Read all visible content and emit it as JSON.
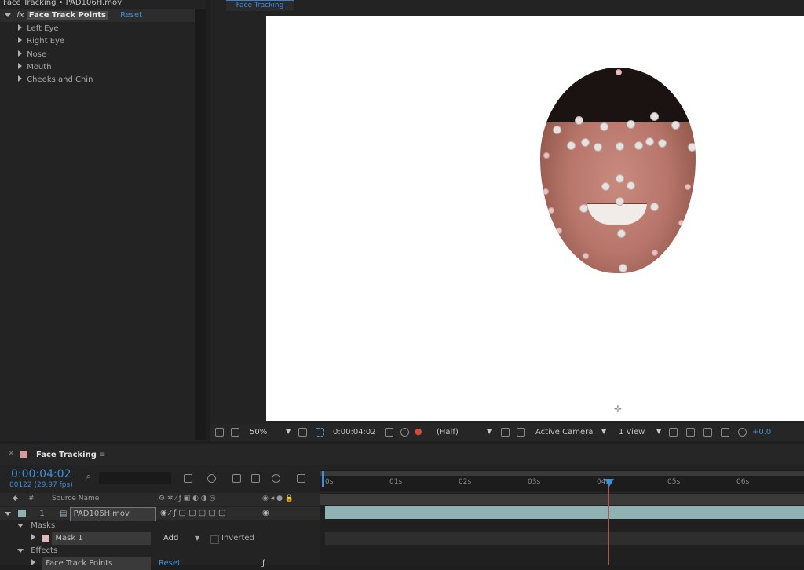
{
  "effect_controls": {
    "title": "Face Tracking • PAD106H.mov",
    "effect_name": "Face Track Points",
    "fx_label": "fx",
    "reset_label": "Reset",
    "groups": [
      "Left Eye",
      "Right Eye",
      "Nose",
      "Mouth",
      "Cheeks and Chin"
    ]
  },
  "viewer": {
    "tab_label": "Face Tracking",
    "toolbar": {
      "zoom": "50%",
      "timecode": "0:00:04:02",
      "resolution": "(Half)",
      "camera": "Active Camera",
      "views": "1 View",
      "exposure": "+0.0"
    },
    "accent_color": "#3d8fd8"
  },
  "timeline": {
    "comp_name": "Face Tracking",
    "timecode": "0:00:04:02",
    "frame_info": "00122 (29.97 fps)",
    "search_placeholder": "",
    "ruler_ticks": [
      "0s",
      "01s",
      "02s",
      "03s",
      "04s",
      "05s",
      "06s"
    ],
    "col_hash": "#",
    "col_source": "Source Name",
    "layer_index": "1",
    "layer_name": "PAD106H.mov",
    "masks_label": "Masks",
    "mask_name": "Mask 1",
    "mask_mode": "Add",
    "inverted_label": "Inverted",
    "effects_label": "Effects",
    "effect_row_name": "Face Track Points",
    "effect_row_reset": "Reset",
    "layer_bar_color": "#8fb2b2",
    "playhead_color": "#d1453b"
  }
}
